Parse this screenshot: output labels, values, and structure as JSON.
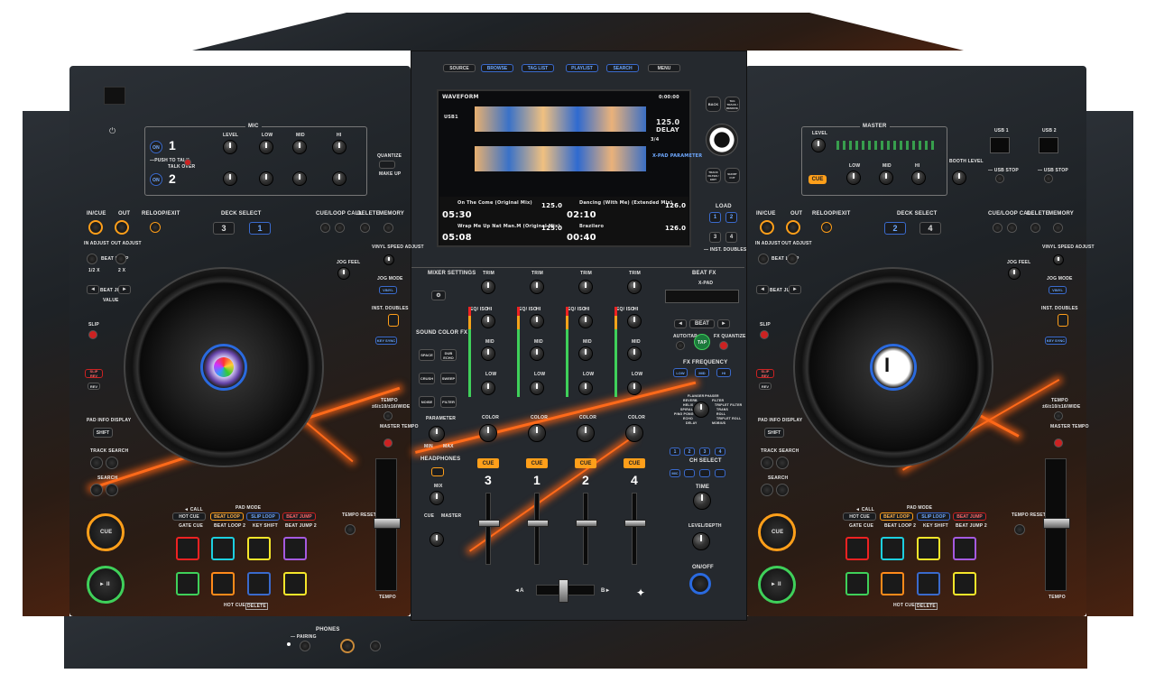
{
  "mic": {
    "title": "MIC",
    "ch1": "1",
    "ch2": "2",
    "on": "ON",
    "push_to_talk": "—PUSH TO TALK",
    "talk_over": "TALK OVER",
    "cut": "CUT",
    "signal": "SIGNAL",
    "level": "LEVEL",
    "low": "LOW",
    "mid": "MID",
    "hi": "HI",
    "quantize": "QUANTIZE",
    "make_up": "MAKE UP"
  },
  "screen": {
    "top_buttons": [
      "SOURCE",
      "BROWSE",
      "TAG LIST",
      "PLAYLIST",
      "SEARCH",
      "MENU"
    ],
    "title": "WAVEFORM",
    "time_clock": "0:00:00",
    "bpm": "125.0",
    "fx_name": "DELAY",
    "beat": "3/4",
    "xpad": "X-PAD PARAMETER",
    "deck_tracks": [
      {
        "name": "On The Come (Original Mix)",
        "time": "05:30",
        "bpm": "125.0"
      },
      {
        "name": "Dancing (With Me) (Extended Mix)",
        "time": "02:10",
        "bpm": "126.0"
      },
      {
        "name": "Wrap Me Up Nat Man.M (Original Mix)",
        "time": "05:08",
        "bpm": "125.0"
      },
      {
        "name": "Brazilero",
        "time": "00:40",
        "bpm": "126.0"
      }
    ],
    "side": {
      "back": "BACK",
      "tag": "TAG TRACK / REMOVE",
      "track_filter": "TRACK FILTER / EDIT",
      "short_cut": "SHORT CUT"
    },
    "usb": "USB1"
  },
  "left": {
    "in_cue": "IN/CUE",
    "out": "OUT",
    "reloop": "RELOOP/EXIT",
    "in_adjust": "IN ADJUST",
    "out_adjust": "OUT ADJUST",
    "deck_select": "DECK SELECT",
    "deck_a": "3",
    "deck_b": "1",
    "cue_loop_call": "CUE/LOOP CALL",
    "delete": "DELETE",
    "memory": "MEMORY",
    "vinyl_speed": "VINYL SPEED ADJUST",
    "beat_loop": "BEAT LOOP",
    "half": "1/2 X",
    "double": "2 X",
    "beat_jump": "BEAT JUMP",
    "value": "VALUE",
    "jog_feel": "JOG FEEL",
    "jog_mode": "JOG MODE",
    "vinyl": "VINYL",
    "inst_doubles": "INST. DOUBLES",
    "key_sync": "KEY SYNC",
    "slip": "SLIP",
    "slip_rev": "SLIP REV",
    "rev": "REV",
    "tempo_range": "TEMPO",
    "wide": "±6/±10/±16/WIDE",
    "master_tempo": "MASTER TEMPO",
    "pad_info": "PAD INFO DISPLAY",
    "shift": "SHIFT",
    "track_search": "TRACK SEARCH",
    "search": "SEARCH",
    "cue": "CUE",
    "play": "► II",
    "tempo_reset": "TEMPO RESET",
    "tempo": "TEMPO",
    "call": "◄ CALL",
    "pad_mode": "PAD MODE",
    "modes": [
      "HOT CUE",
      "BEAT LOOP",
      "SLIP LOOP",
      "BEAT JUMP"
    ],
    "modes2": [
      "GATE CUE",
      "BEAT LOOP 2",
      "KEY SHIFT",
      "BEAT JUMP 2"
    ],
    "hot_cue": "HOT CUE",
    "delete_small": "DELETE"
  },
  "right": {
    "deck_a": "2",
    "deck_b": "4",
    "master": "MASTER",
    "level": "LEVEL",
    "low": "LOW",
    "mid": "MID",
    "hi": "HI",
    "booth": "BOOTH LEVEL",
    "cue": "CUE",
    "usb1": "USB 1",
    "usb2": "USB 2",
    "usb_stop": "— USB STOP"
  },
  "mixer": {
    "settings": "MIXER SETTINGS",
    "sound_color_fx": "SOUND COLOR FX",
    "fx": [
      "SPACE",
      "DUB ECHO",
      "CRUSH",
      "SWEEP",
      "NOISE",
      "FILTER"
    ],
    "parameter": "PARAMETER",
    "min": "MIN",
    "max": "MAX",
    "headphones": "HEADPHONES",
    "mix": "MIX",
    "cue": "CUE",
    "master": "MASTER",
    "trim": "TRIM",
    "eq": "EQ/ ISO",
    "hi": "HI",
    "mid": "MID",
    "low": "LOW",
    "color": "COLOR",
    "channels": [
      "3",
      "1",
      "2",
      "4"
    ],
    "xfade_a": "◄A",
    "xfade_b": "B►"
  },
  "beatfx": {
    "title": "BEAT FX",
    "xpad": "X-PAD",
    "beat": "BEAT",
    "auto_tap": "AUTO/TAP",
    "tap": "TAP",
    "fx_quantize": "FX QUANTIZE",
    "fx_frequency": "FX FREQUENCY",
    "freq": [
      "LOW",
      "MID",
      "HI"
    ],
    "effects": [
      "FLANGER",
      "REVERB",
      "HELIX",
      "SPIRAL",
      "PING PONG",
      "ECHO",
      "DELAY",
      "PHASER",
      "FILTER",
      "TRIPLET FILTER",
      "TRANS",
      "ROLL",
      "TRIPLET ROLL",
      "MOBIUS"
    ],
    "ch_select": "CH SELECT",
    "chs": [
      "1",
      "2",
      "3",
      "4"
    ],
    "mic": "MIC",
    "time": "TIME",
    "level_depth": "LEVEL/DEPTH",
    "on_off": "ON/OFF",
    "load": "LOAD",
    "load_a": "1",
    "load_b": "2",
    "load_c": "3",
    "load_d": "4",
    "inst_doubles": "— INST. DOUBLES"
  },
  "phones": {
    "title": "PHONES",
    "pairing": "— PAIRING"
  },
  "colors": {
    "accent": "#ff6a1a",
    "cue": "#ff9f1a",
    "blue": "#3a6acc"
  }
}
